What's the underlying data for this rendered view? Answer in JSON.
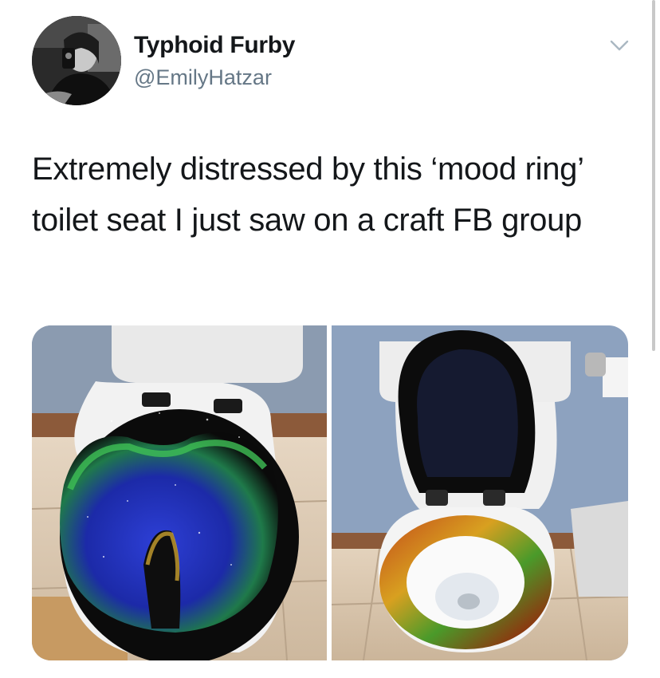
{
  "tweet": {
    "author": {
      "display_name": "Typhoid Furby",
      "handle": "@EmilyHatzar",
      "avatar_icon": "profile-photo"
    },
    "menu_icon": "chevron-down-icon",
    "text": "Extremely distressed by this ‘mood ring’ toilet seat I just saw on a craft FB group",
    "media": {
      "count": 2,
      "photos": [
        {
          "subject": "closed-toilet-seat-photo"
        },
        {
          "subject": "open-toilet-seat-photo"
        }
      ]
    }
  },
  "colors": {
    "text_primary": "#14171a",
    "text_secondary": "#657786",
    "background": "#ffffff",
    "chevron": "#aab8c2"
  }
}
